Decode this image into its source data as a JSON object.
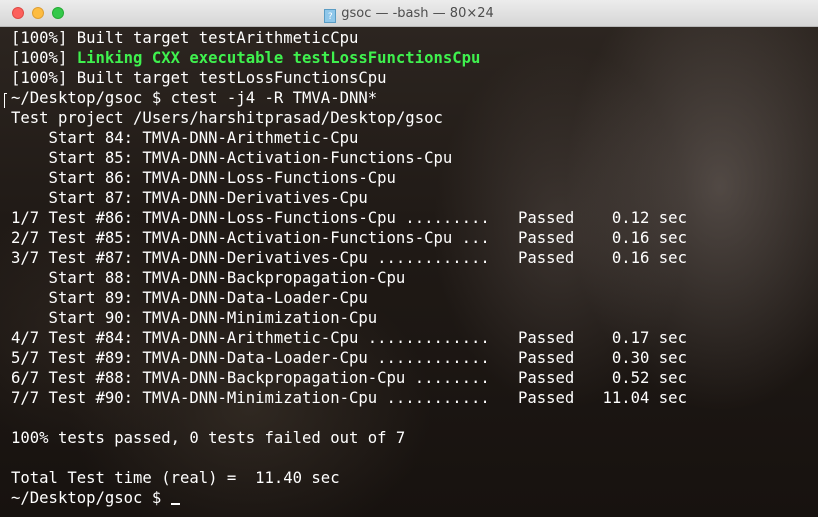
{
  "window": {
    "title": "gsoc — -bash — 80×24",
    "title_icon": "?"
  },
  "lines": [
    {
      "text": "[100%] Built target testArithmeticCpu"
    },
    {
      "prefix": "[100%] ",
      "highlight": "Linking CXX executable testLossFunctionsCpu"
    },
    {
      "text": "[100%] Built target testLossFunctionsCpu"
    },
    {
      "text": "~/Desktop/gsoc $ ctest -j4 -R TMVA-DNN*"
    },
    {
      "text": "Test project /Users/harshitprasad/Desktop/gsoc"
    },
    {
      "text": "    Start 84: TMVA-DNN-Arithmetic-Cpu"
    },
    {
      "text": "    Start 85: TMVA-DNN-Activation-Functions-Cpu"
    },
    {
      "text": "    Start 86: TMVA-DNN-Loss-Functions-Cpu"
    },
    {
      "text": "    Start 87: TMVA-DNN-Derivatives-Cpu"
    },
    {
      "text": "1/7 Test #86: TMVA-DNN-Loss-Functions-Cpu .........   Passed    0.12 sec"
    },
    {
      "text": "2/7 Test #85: TMVA-DNN-Activation-Functions-Cpu ...   Passed    0.16 sec"
    },
    {
      "text": "3/7 Test #87: TMVA-DNN-Derivatives-Cpu ............   Passed    0.16 sec"
    },
    {
      "text": "    Start 88: TMVA-DNN-Backpropagation-Cpu"
    },
    {
      "text": "    Start 89: TMVA-DNN-Data-Loader-Cpu"
    },
    {
      "text": "    Start 90: TMVA-DNN-Minimization-Cpu"
    },
    {
      "text": "4/7 Test #84: TMVA-DNN-Arithmetic-Cpu .............   Passed    0.17 sec"
    },
    {
      "text": "5/7 Test #89: TMVA-DNN-Data-Loader-Cpu ............   Passed    0.30 sec"
    },
    {
      "text": "6/7 Test #88: TMVA-DNN-Backpropagation-Cpu ........   Passed    0.52 sec"
    },
    {
      "text": "7/7 Test #90: TMVA-DNN-Minimization-Cpu ...........   Passed   11.04 sec"
    },
    {
      "text": ""
    },
    {
      "text": "100% tests passed, 0 tests failed out of 7"
    },
    {
      "text": ""
    },
    {
      "text": "Total Test time (real) =  11.40 sec"
    },
    {
      "text": "~/Desktop/gsoc $ "
    }
  ],
  "colors": {
    "text": "#ffffff",
    "highlight": "#3ff14e",
    "close": "#fc605c",
    "minimize": "#fdbc40",
    "maximize": "#34c84a"
  }
}
